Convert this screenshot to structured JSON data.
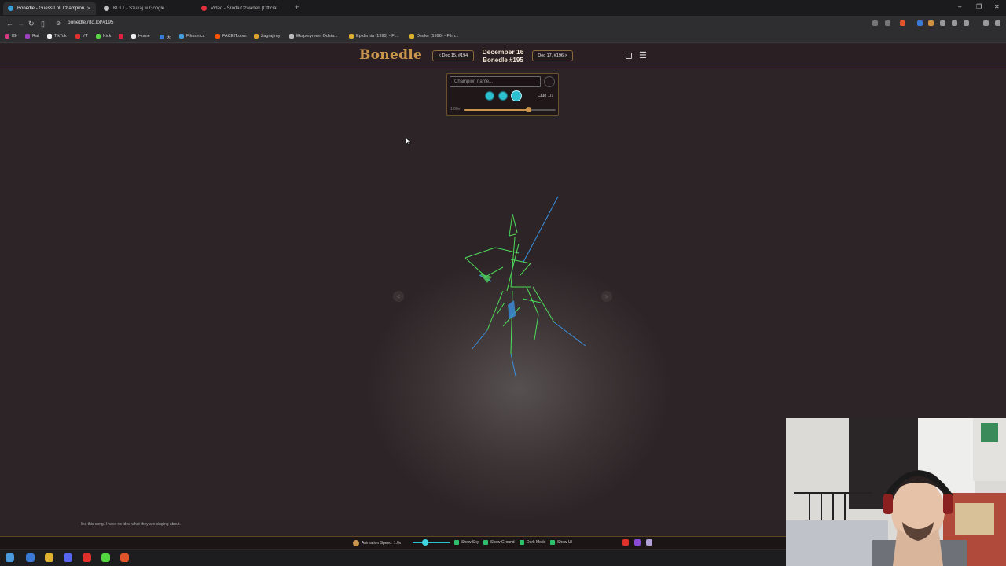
{
  "browser": {
    "tabs": [
      {
        "title": "Bonedle - Guess LoL Champion",
        "active": true,
        "fav_color": "#3aa0d8"
      },
      {
        "title": "KULT - Szukaj w Google",
        "active": false,
        "fav_color": "#bdbdbd"
      },
      {
        "title": "Video - Środa Czwartek [Official",
        "active": false,
        "fav_color": "#e0303a"
      }
    ],
    "new_tab": "+",
    "url": "bonedle.rito.lol/#195",
    "bookmarks": [
      {
        "label": "IG",
        "color": "#d63a82"
      },
      {
        "label": "Rat",
        "color": "#a040c0"
      },
      {
        "label": "TikTok",
        "color": "#eeeeee"
      },
      {
        "label": "YT",
        "color": "#e0302a"
      },
      {
        "label": "Kick",
        "color": "#53d640"
      },
      {
        "label": "",
        "color": "#e02040"
      },
      {
        "label": "Home",
        "color": "#eeeeee"
      },
      {
        "label": "天",
        "color": "#3a7ad6"
      },
      {
        "label": "Filman.cc",
        "color": "#40a0e0"
      },
      {
        "label": "FACEIT.com",
        "color": "#ff5500"
      },
      {
        "label": "Zagraj.my",
        "color": "#e0a030"
      },
      {
        "label": "Eksperyment Odsia...",
        "color": "#bbbbbb"
      },
      {
        "label": "Epidemia (1995) - Fi...",
        "color": "#e0b030"
      },
      {
        "label": "Dealer (1996) - Film...",
        "color": "#e0b030"
      }
    ]
  },
  "header": {
    "logo": "Bonedle",
    "prev_day": "< Dec 15, #194",
    "day_title": "December 16",
    "day_subtitle": "Bonedle #195",
    "next_day": "Dec 17, #196 >"
  },
  "guess_panel": {
    "input_placeholder": "Champion name...",
    "clue_label": "Clue 1/1",
    "speed_label": "1.00x",
    "speed_level": 0.7,
    "accent_color": "#2bbfd0"
  },
  "viewer": {
    "prev_arrow": "<",
    "next_arrow": ">"
  },
  "bottom_bar": {
    "animation_speed_label": "Animation Speed: 1.0x",
    "options": [
      "Show Sky",
      "Show Ground",
      "Dark Mode",
      "Show UI"
    ]
  },
  "bottom_strip_text": "I like this song. I have no idea what they are singing about.",
  "colors": {
    "brand_gold": "#c9954c",
    "background": "#2c2426",
    "skeleton_green": "#4fdc5a",
    "skeleton_blue": "#3aa0e0"
  }
}
